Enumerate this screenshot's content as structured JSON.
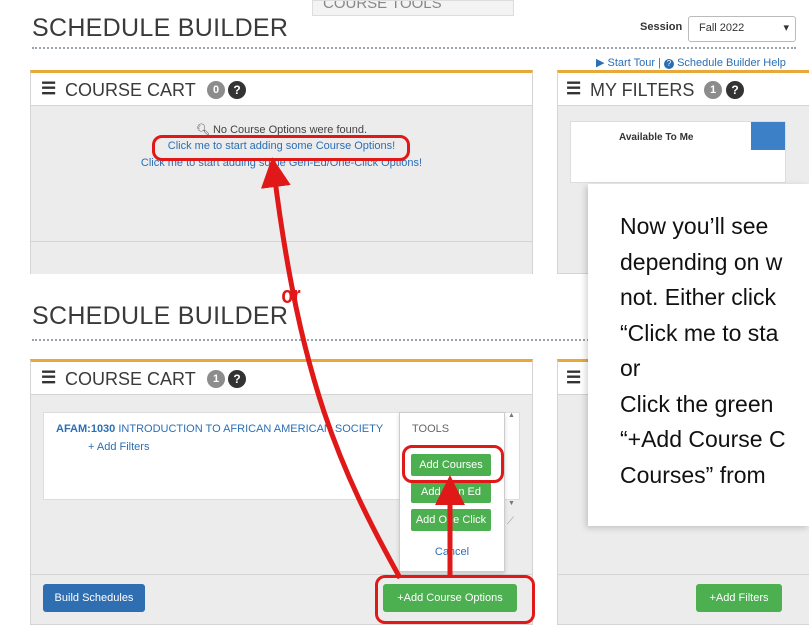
{
  "top": {
    "title": "SCHEDULE BUILDER",
    "course_tools_label": "COURSE TOOLS",
    "session_label": "Session",
    "session_value": "Fall 2022",
    "start_tour": "Start Tour",
    "help": "Schedule Builder Help"
  },
  "cart_top": {
    "title": "COURSE CART",
    "count": "0",
    "no_options": "No Course Options were found.",
    "link1": "Click me to start adding some Course Options!",
    "link2": "Click me to start adding some Gen-Ed/One-Click Options!"
  },
  "filters_top": {
    "title": "MY FILTERS",
    "count": "1",
    "available": "Available To Me"
  },
  "annotation": {
    "or_label": "or",
    "lines": [
      "Now you’ll see",
      "depending on w",
      "not. Either click",
      "“Click me to sta",
      "or",
      "Click the green",
      "“+Add Course C",
      "Courses” from"
    ]
  },
  "bottom": {
    "title": "SCHEDULE BUILDER",
    "cart_title": "COURSE CART",
    "cart_count": "1",
    "course_code": "AFAM:1030",
    "course_name": "INTRODUCTION TO AFRICAN AMERICAN SOCIETY",
    "add_filters_link": "+ Add Filters",
    "tools_label": "TOOLS",
    "tools_add_courses": "Add Courses",
    "tools_add_gened": "Add Gen Ed",
    "tools_add_oneclick": "Add One Click",
    "tools_cancel": "Cancel",
    "build_schedules": "Build Schedules",
    "add_course_options": "+Add Course Options",
    "add_filters_button": "+Add Filters"
  },
  "colors": {
    "annotation_red": "#e01818",
    "green": "#4caf50",
    "blue": "#2f6eb0",
    "panel_accent": "#e8a93a"
  }
}
